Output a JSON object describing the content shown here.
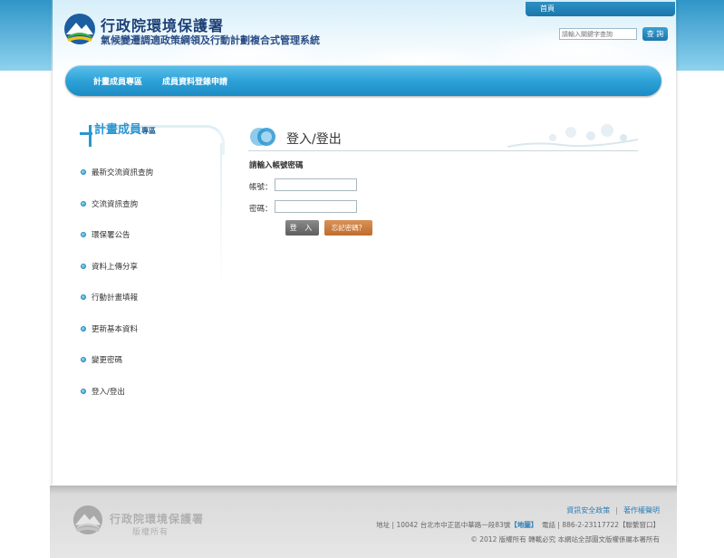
{
  "header": {
    "site_title": "行政院環境保護署",
    "site_subtitle": "氣候變遷調適政策綱領及行動計劃複合式管理系統",
    "home_label": "首頁",
    "search_placeholder": "請輸入關鍵字查詢",
    "search_button": "查 詢"
  },
  "nav": {
    "items": [
      {
        "label": "計畫成員專區"
      },
      {
        "label": "成員資料登錄申請"
      }
    ]
  },
  "sidebar": {
    "title_main": "計畫成員",
    "title_suffix": "專區",
    "items": [
      {
        "label": "最新交流資訊查詢"
      },
      {
        "label": "交流資訊查詢"
      },
      {
        "label": "環保署公告"
      },
      {
        "label": "資料上傳分享"
      },
      {
        "label": "行動計畫填報"
      },
      {
        "label": "更新基本資料"
      },
      {
        "label": "變更密碼"
      },
      {
        "label": "登入/登出"
      }
    ]
  },
  "login": {
    "title": "登入/登出",
    "hint": "請輸入帳號密碼",
    "account_label": "帳號：",
    "password_label": "密碼：",
    "account_value": "",
    "password_value": "",
    "login_button": "登 入",
    "forgot_button": "忘記密碼？"
  },
  "footer": {
    "org_name": "行政院環境保護署",
    "rights": "版權所有",
    "link_security": "資訊安全政策",
    "link_copyright": "著作權聲明",
    "address_prefix": "地址 | 10042 台北市中正區中華路一段83號",
    "map_label": "【地圖】",
    "phone": "電話 | 886-2-23117722【聯繫窗口】",
    "copyright": "© 2012 版權所有 轉載必究 本網站全部圖文版權係屬本署所有"
  },
  "colors": {
    "brand_blue": "#2c96d1",
    "nav_blue": "#2ea2d8",
    "title_navy": "#1c3f75",
    "login_button": "#5e5e5e",
    "forgot_button": "#bf6c2d"
  }
}
